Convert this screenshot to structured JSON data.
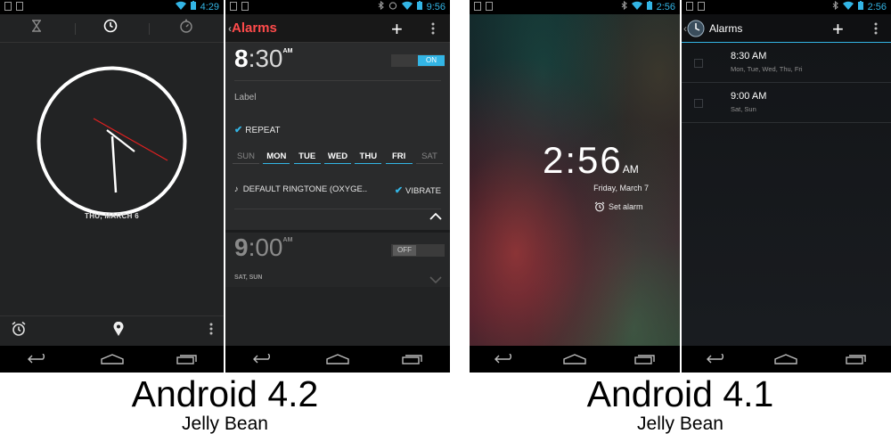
{
  "phone_clock": {
    "status_time": "4:29",
    "date": "THU, MARCH 6"
  },
  "phone_alarms_42": {
    "status_time": "9:56",
    "title": "Alarms",
    "alarm1": {
      "hour": "8",
      "minutes": ":30",
      "ampm": "AM",
      "toggle": "ON"
    },
    "label": "Label",
    "repeat": "REPEAT",
    "days": [
      {
        "label": "SUN",
        "on": false
      },
      {
        "label": "MON",
        "on": true
      },
      {
        "label": "TUE",
        "on": true
      },
      {
        "label": "WED",
        "on": true
      },
      {
        "label": "THU",
        "on": true
      },
      {
        "label": "FRI",
        "on": true
      },
      {
        "label": "SAT",
        "on": false
      }
    ],
    "ringtone": "DEFAULT RINGTONE (OXYGE..",
    "vibrate": "VIBRATE",
    "alarm2": {
      "hour": "9",
      "minutes": ":00",
      "ampm": "AM",
      "toggle": "OFF",
      "days": "SAT, SUN"
    }
  },
  "phone_lock_41": {
    "status_time": "2:56",
    "time": "2:56",
    "ampm": "AM",
    "date": "Friday, March 7",
    "set_alarm": "Set alarm"
  },
  "phone_alarms_41": {
    "status_time": "2:56",
    "title": "Alarms",
    "alarms": [
      {
        "time": "8:30 AM",
        "days": "Mon, Tue, Wed, Thu, Fri"
      },
      {
        "time": "9:00 AM",
        "days": "Sat, Sun"
      }
    ]
  },
  "captions": {
    "left": {
      "version": "Android 4.2",
      "name": "Jelly Bean"
    },
    "right": {
      "version": "Android 4.1",
      "name": "Jelly Bean"
    }
  },
  "colors": {
    "holo_blue": "#33b5e5",
    "red_accent": "#ff4b4b"
  }
}
